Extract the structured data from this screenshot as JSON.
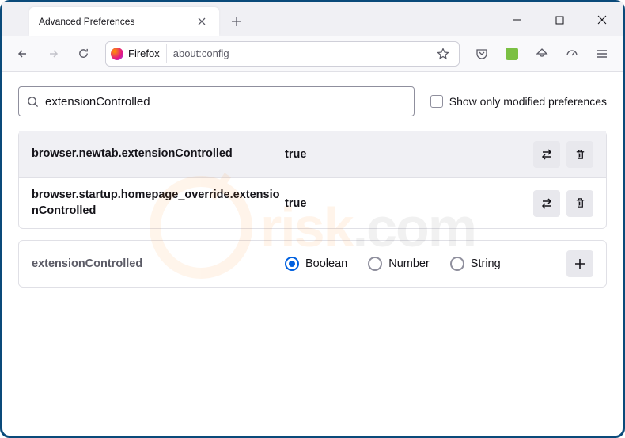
{
  "tab": {
    "title": "Advanced Preferences"
  },
  "urlbar": {
    "identity": "Firefox",
    "url": "about:config"
  },
  "search": {
    "value": "extensionControlled"
  },
  "checkbox": {
    "label": "Show only modified preferences"
  },
  "prefs": [
    {
      "name": "browser.newtab.extensionControlled",
      "value": "true"
    },
    {
      "name": "browser.startup.homepage_override.extensionControlled",
      "value": "true"
    }
  ],
  "newPref": {
    "name": "extensionControlled",
    "types": {
      "boolean": "Boolean",
      "number": "Number",
      "string": "String"
    }
  },
  "watermark": {
    "text1": "risk",
    "text2": ".com"
  }
}
